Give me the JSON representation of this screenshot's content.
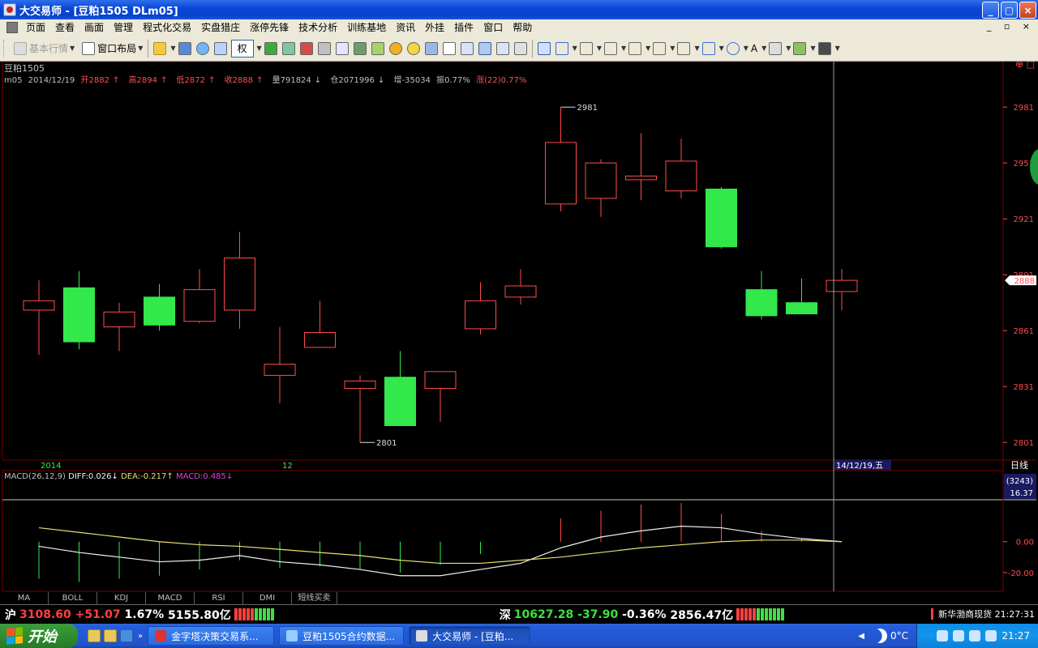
{
  "window": {
    "title": "大交易师 - [豆粕1505 DLm05]",
    "min": "_",
    "max": "▢",
    "close": "×"
  },
  "menu": {
    "items": [
      "页面",
      "查看",
      "画面",
      "管理",
      "程式化交易",
      "实盘猎庄",
      "涨停先锋",
      "技术分析",
      "训练基地",
      "资讯",
      "外挂",
      "插件",
      "窗口",
      "帮助"
    ],
    "mdi": "_ ▫ ×"
  },
  "toolbar": {
    "quote": "基本行情",
    "layout": "窗口布局",
    "quan": "权",
    "text_tool": "A"
  },
  "instrument": {
    "name": "豆粕1505",
    "code": "m05",
    "date": "2014/12/19",
    "open": "开2882",
    "high": "高2894",
    "low": "低2872",
    "close": "收2888",
    "volume": "量791824",
    "oi": "仓2071996",
    "oi_change": "增-35034",
    "amplitude": "振0.77%",
    "change": "涨(22)0.77%",
    "up": "↑",
    "down": "↓"
  },
  "chart_data": {
    "type": "candlestick",
    "ylim": [
      2795,
      2995
    ],
    "yticks": [
      "2981",
      "2951",
      "2921",
      "2891",
      "2861",
      "2831",
      "2801"
    ],
    "current_price": "2888",
    "high_label": "2981",
    "low_label": "2801",
    "xlabels": [
      "2014",
      "12"
    ],
    "cursor_date": "14/12/19,五",
    "period": "日线",
    "candles": [
      {
        "o": 2872,
        "h": 2888,
        "l": 2848,
        "c": 2877
      },
      {
        "o": 2884,
        "h": 2893,
        "l": 2851,
        "c": 2855
      },
      {
        "o": 2863,
        "h": 2876,
        "l": 2850,
        "c": 2871
      },
      {
        "o": 2879,
        "h": 2886,
        "l": 2861,
        "c": 2864
      },
      {
        "o": 2866,
        "h": 2894,
        "l": 2865,
        "c": 2883
      },
      {
        "o": 2872,
        "h": 2914,
        "l": 2862,
        "c": 2900
      },
      {
        "o": 2837,
        "h": 2863,
        "l": 2822,
        "c": 2843
      },
      {
        "o": 2852,
        "h": 2877,
        "l": 2852,
        "c": 2860
      },
      {
        "o": 2830,
        "h": 2837,
        "l": 2801,
        "c": 2834
      },
      {
        "o": 2836,
        "h": 2850,
        "l": 2818,
        "c": 2810
      },
      {
        "o": 2830,
        "h": 2838,
        "l": 2812,
        "c": 2839
      },
      {
        "o": 2862,
        "h": 2887,
        "l": 2859,
        "c": 2877
      },
      {
        "o": 2879,
        "h": 2894,
        "l": 2875,
        "c": 2885
      },
      {
        "o": 2929,
        "h": 2981,
        "l": 2925,
        "c": 2962
      },
      {
        "o": 2932,
        "h": 2953,
        "l": 2922,
        "c": 2951
      },
      {
        "o": 2942,
        "h": 2967,
        "l": 2931,
        "c": 2944
      },
      {
        "o": 2936,
        "h": 2964,
        "l": 2932,
        "c": 2952
      },
      {
        "o": 2937,
        "h": 2938,
        "l": 2905,
        "c": 2906
      },
      {
        "o": 2883,
        "h": 2893,
        "l": 2867,
        "c": 2869
      },
      {
        "o": 2876,
        "h": 2889,
        "l": 2872,
        "c": 2870
      },
      {
        "o": 2882,
        "h": 2894,
        "l": 2872,
        "c": 2888
      }
    ],
    "macd": {
      "title": "MACD(26,12,9)",
      "diff": "DIFF:0.026",
      "dea": "DEA:-0.217",
      "macd": "MACD:0.485",
      "ylim": [
        -30,
        25
      ],
      "yticks": [
        "0.00",
        "-20.00"
      ],
      "readout_top": "(3243)",
      "readout_val": "16.37",
      "diff_series": [
        -3,
        -7,
        -10,
        -13,
        -12,
        -9,
        -13,
        -15,
        -18,
        -22,
        -22,
        -18,
        -14,
        -4,
        3,
        7,
        10,
        9,
        5,
        2,
        0
      ],
      "dea_series": [
        9,
        6,
        3,
        0,
        -2,
        -3,
        -5,
        -7,
        -9,
        -12,
        -14,
        -14,
        -12,
        -10,
        -7,
        -4,
        -2,
        0,
        1,
        1,
        0
      ],
      "hist": [
        -24,
        -26,
        -24,
        -22,
        -18,
        -12,
        -17,
        -16,
        -18,
        -20,
        -15,
        -8,
        0,
        15,
        20,
        24,
        25,
        18,
        7,
        2,
        0
      ]
    }
  },
  "indicator_tabs": [
    "MA",
    "BOLL",
    "KDJ",
    "MACD",
    "RSI",
    "DMI",
    "短线买卖"
  ],
  "status": {
    "sh_label": "沪",
    "sh_index": "3108.60",
    "sh_change": "+51.07",
    "sh_pct": "1.67%",
    "sh_amount": "5155.80亿",
    "sz_label": "深",
    "sz_index": "10627.28",
    "sz_change": "-37.90",
    "sz_pct": "-0.36%",
    "sz_amount": "2856.47亿",
    "news": "新华渤商现货",
    "time": "21:27:31"
  },
  "taskbar": {
    "start": "开始",
    "tasks": [
      "金字塔决策交易系...",
      "豆粕1505合约数据...",
      "大交易师 - [豆粕..."
    ],
    "weather": "0°C",
    "clock": "21:27"
  }
}
